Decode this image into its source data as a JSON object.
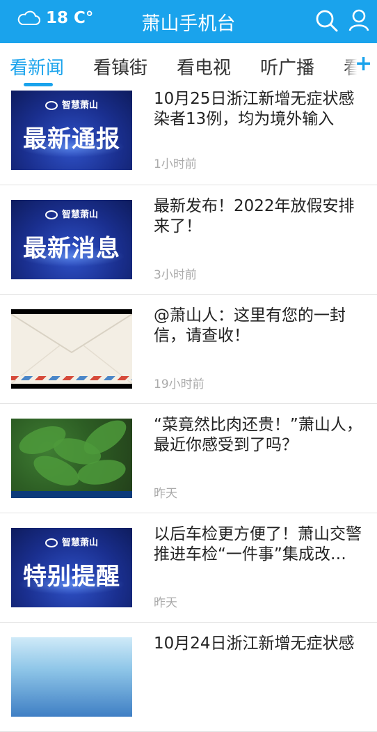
{
  "header": {
    "temperature": "18 C°",
    "title": "萧山手机台"
  },
  "tabs": [
    {
      "label": "看新闻",
      "active": true
    },
    {
      "label": "看镇街",
      "active": false
    },
    {
      "label": "看电视",
      "active": false
    },
    {
      "label": "听广播",
      "active": false
    },
    {
      "label": "看",
      "active": false
    }
  ],
  "add_label": "+",
  "news": [
    {
      "title": "10月25日浙江新增无症状感染者13例，均为境外输入",
      "time": "1小时前",
      "thumb_brand": "智慧萧山",
      "thumb_text": "最新通报"
    },
    {
      "title": "最新发布！2022年放假安排来了！",
      "time": "3小时前",
      "thumb_brand": "智慧萧山",
      "thumb_text": "最新消息"
    },
    {
      "title": "@萧山人：这里有您的一封信，请查收！",
      "time": "19小时前",
      "thumb_kind": "envelope"
    },
    {
      "title": "“菜竟然比肉还贵！”萧山人，最近你感受到了吗？",
      "time": "昨天",
      "thumb_kind": "vegetables"
    },
    {
      "title": "以后车检更方便了！萧山交警推进车检“一件事”集成改…",
      "time": "昨天",
      "thumb_brand": "智慧萧山",
      "thumb_text": "特别提醒"
    },
    {
      "title": "10月24日浙江新增无症状感",
      "time": "",
      "thumb_kind": "blue"
    }
  ],
  "colors": {
    "accent": "#1aa3ec",
    "text": "#222222",
    "muted": "#aaaaaa"
  }
}
